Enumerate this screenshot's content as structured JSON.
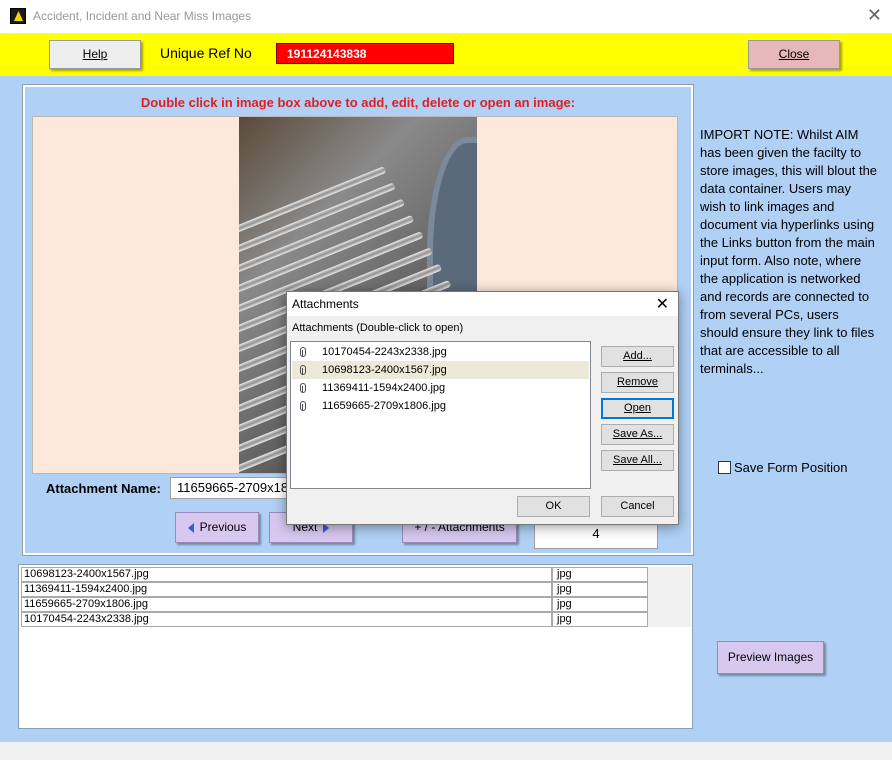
{
  "window": {
    "title": "Accident, Incident and Near Miss Images",
    "close_glyph": "✕"
  },
  "header": {
    "help_label": "Help",
    "ref_label": "Unique Ref No",
    "ref_value": "191124143838",
    "close_label": "Close",
    "colors": {
      "header_bg": "#ffff00",
      "ref_bg": "#ff0000",
      "close_btn_bg": "#e6b8b8"
    }
  },
  "image_panel": {
    "instruction": "Double click in image box above to add, edit, delete or open an image:",
    "attachment_name_label": "Attachment Name:",
    "attachment_name_value": "11659665-2709x1806.jpg",
    "previous_label": "Previous",
    "next_label": "Next",
    "attachments_label": "+ / -  Attachments",
    "count": "4"
  },
  "image_list": {
    "rows": [
      {
        "name": "10698123-2400x1567.jpg",
        "ext": "jpg"
      },
      {
        "name": "11369411-1594x2400.jpg",
        "ext": "jpg"
      },
      {
        "name": "11659665-2709x1806.jpg",
        "ext": "jpg"
      },
      {
        "name": "10170454-2243x2338.jpg",
        "ext": "jpg"
      }
    ]
  },
  "notice": "IMPORT NOTE:  Whilst AIM has been given the facilty to store images, this will blout the data container. Users may wish to link images and document via hyperlinks using the Links button from the main input form.  Also note, where the application is networked and records are connected to from several PCs, users should ensure they link to files that are accessible to all terminals...",
  "save_form_position": {
    "label": "Save Form Position",
    "checked": false
  },
  "preview_label": "Preview Images",
  "dialog": {
    "title": "Attachments",
    "close_glyph": "✕",
    "subtitle": "Attachments (Double-click to open)",
    "files": [
      "10170454-2243x2338.jpg",
      "10698123-2400x1567.jpg",
      "11369411-1594x2400.jpg",
      "11659665-2709x1806.jpg"
    ],
    "selected_index": 1,
    "buttons": {
      "add": "Add...",
      "remove": "Remove",
      "open": "Open",
      "save_as": "Save As...",
      "save_all": "Save All...",
      "ok": "OK",
      "cancel": "Cancel"
    }
  },
  "icons": {
    "app": "app-hazard-icon",
    "attachment": "paperclip-icon",
    "prev": "arrow-left-icon",
    "next": "arrow-right-icon"
  }
}
